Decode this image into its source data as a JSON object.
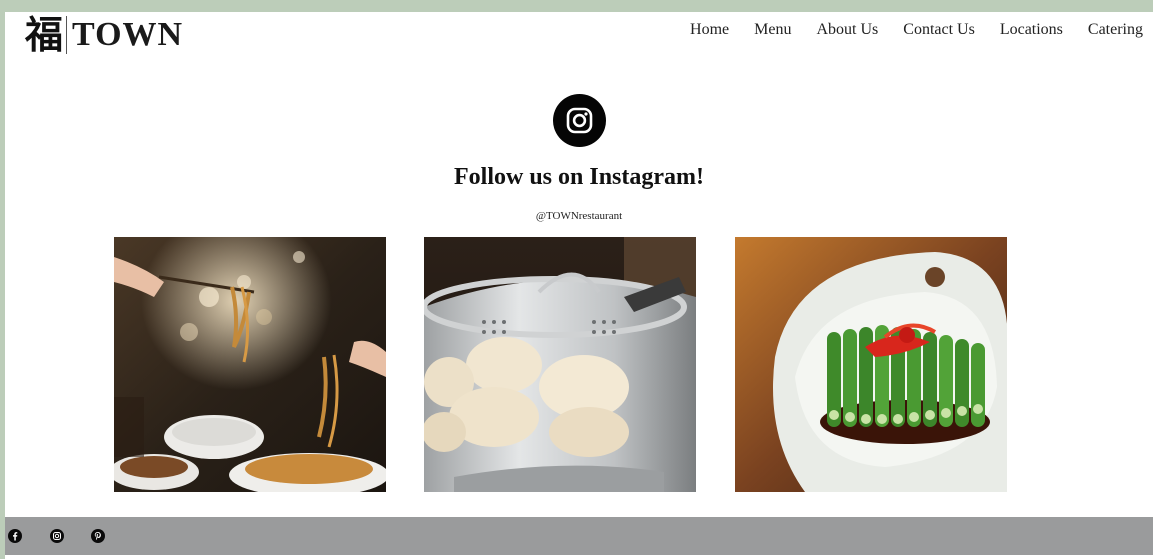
{
  "header": {
    "logo_char": "福",
    "logo_text": "TOWN",
    "nav": [
      "Home",
      "Menu",
      "About Us",
      "Contact Us",
      "Locations",
      "Catering"
    ]
  },
  "instagram": {
    "icon": "instagram-icon",
    "heading": "Follow us on Instagram!",
    "handle": "@TOWNrestaurant"
  },
  "gallery": [
    {
      "subject": "noodles-photo"
    },
    {
      "subject": "steamed-buns-photo"
    },
    {
      "subject": "okra-dish-photo"
    }
  ],
  "footer": {
    "social_icons": [
      "facebook-icon",
      "instagram-icon",
      "pinterest-icon"
    ]
  },
  "colors": {
    "frame": "#bccdb9",
    "footer": "#9a9b9c",
    "text": "#111111"
  }
}
